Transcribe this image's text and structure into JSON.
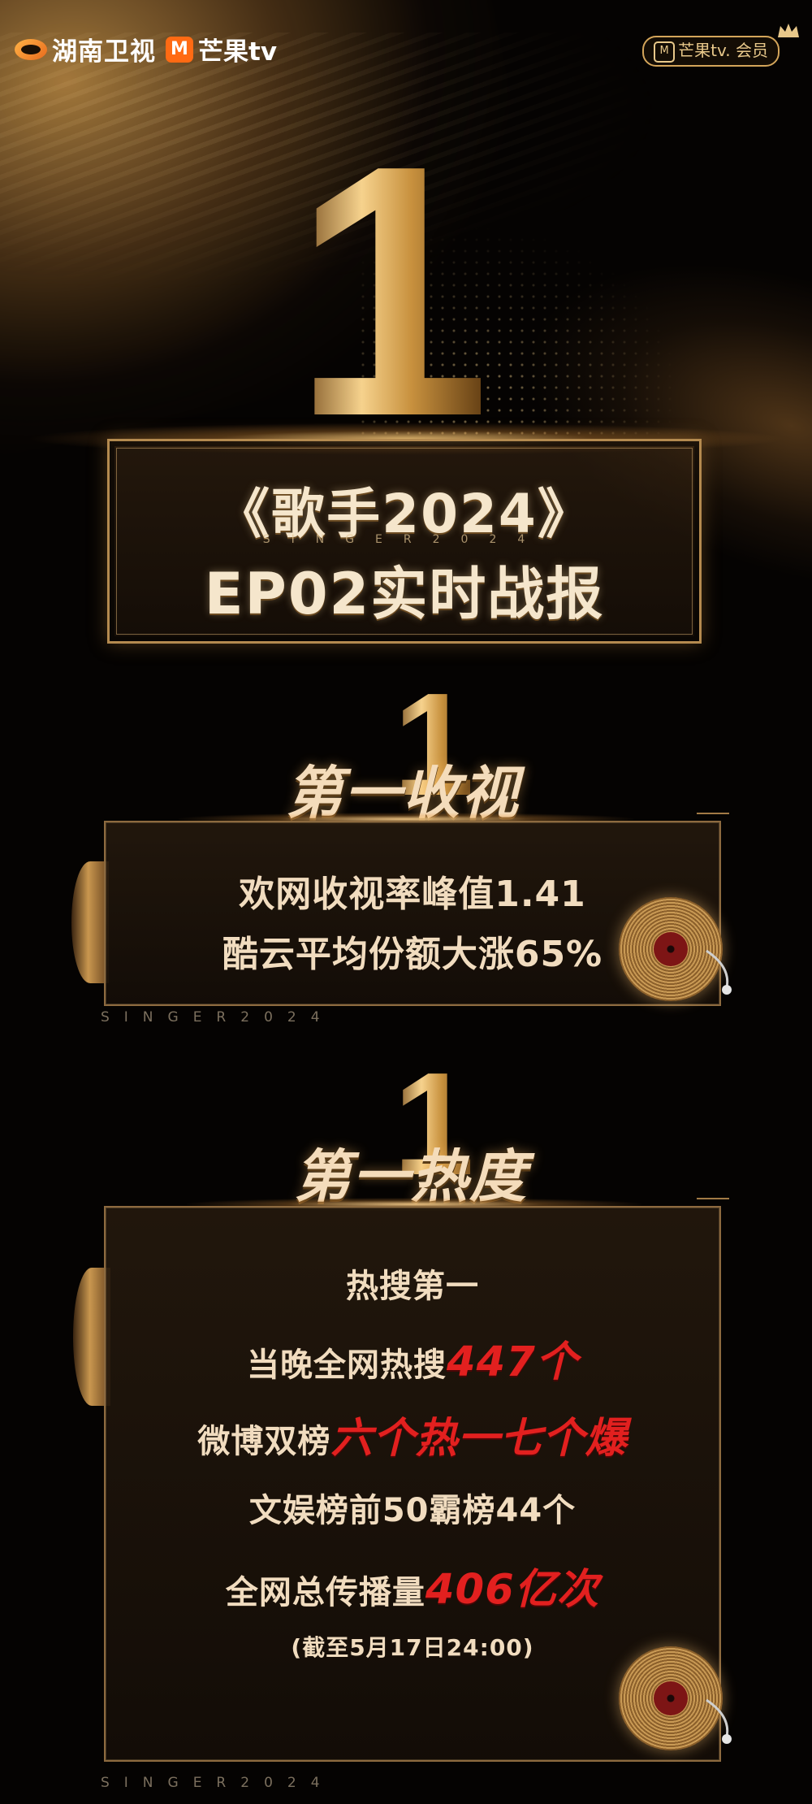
{
  "header": {
    "hunan_logo_text": "湖南卫视",
    "mango_mark": "M",
    "mango_text": "芒果tv",
    "vip_badge": "芒果tv. 会员"
  },
  "title": {
    "big_rank": "1",
    "line1": "《歌手2024》",
    "subtitle": "SINGER2024",
    "line2": "EP02实时战报"
  },
  "sections": [
    {
      "rank": "1",
      "heading": "第一收视",
      "lines": [
        "欢网收视率峰值1.41",
        "酷云平均份额大涨65%"
      ],
      "tag": "SINGER2024"
    },
    {
      "rank": "1",
      "heading": "第一热度",
      "lines": [
        {
          "text": "热搜第一"
        },
        {
          "text": "当晚全网热搜",
          "highlight": "447个"
        },
        {
          "text": "微博双榜",
          "highlight": "六个热一七个爆"
        },
        {
          "text": "文娱榜前50霸榜44个"
        },
        {
          "text": "全网总传播量",
          "highlight": "406亿次"
        }
      ],
      "note": "(截至5月17日24:00)",
      "tag": "SINGER2024"
    }
  ],
  "colors": {
    "gold": "#c9974f",
    "cream_text": "#f1dcbf",
    "highlight_red": "#e2201f",
    "background": "#050302"
  }
}
